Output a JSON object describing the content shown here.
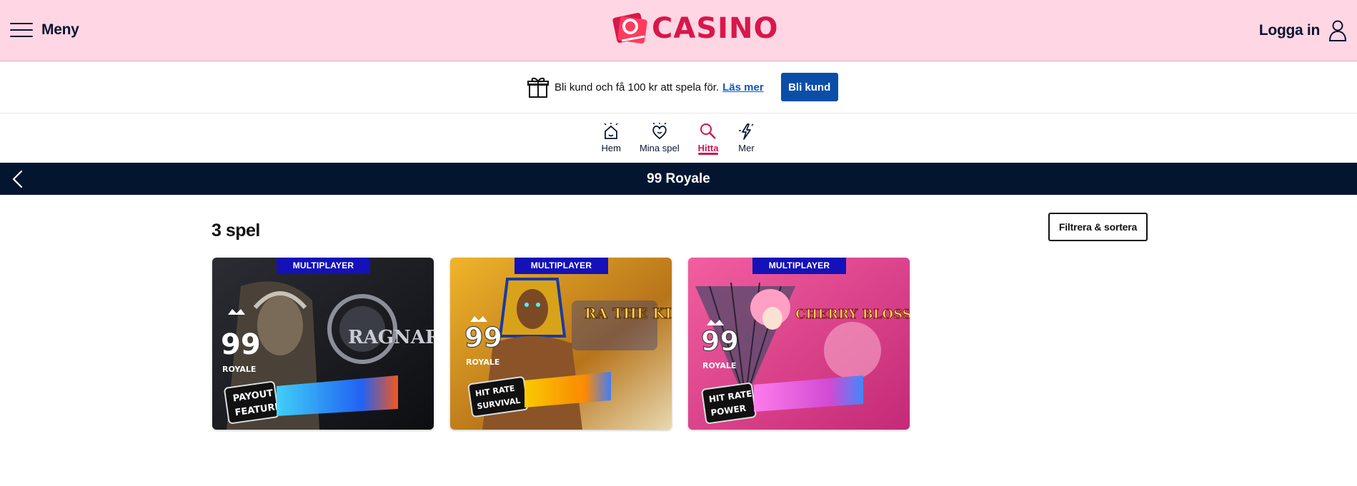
{
  "header": {
    "menu_label": "Meny",
    "logo_text": "CASINO",
    "login_label": "Logga in"
  },
  "promo": {
    "text": "Bli kund och få 100 kr att spela för.",
    "link": "Läs mer",
    "button": "Bli kund"
  },
  "nav": {
    "tabs": [
      {
        "label": "Hem",
        "icon": "home-icon"
      },
      {
        "label": "Mina spel",
        "icon": "heart-icon"
      },
      {
        "label": "Hitta",
        "icon": "search-icon",
        "active": true
      },
      {
        "label": "Mer",
        "icon": "lightning-icon"
      }
    ]
  },
  "titlebar": {
    "title": "99 Royale"
  },
  "content": {
    "count": "3 spel",
    "filter_button": "Filtrera & sortera"
  },
  "games": [
    {
      "badge": "MULTIPLAYER",
      "brand": "99",
      "brand_sub": "ROYALE",
      "title": "RAGNAROK",
      "feature_line1": "PAYOUT",
      "feature_line2": "FEATURE"
    },
    {
      "badge": "MULTIPLAYER",
      "brand": "99",
      "brand_sub": "ROYALE",
      "title": "RA THE KING",
      "feature_line1": "HIT RATE",
      "feature_line2": "SURVIVAL"
    },
    {
      "badge": "MULTIPLAYER",
      "brand": "99",
      "brand_sub": "ROYALE",
      "title": "CHERRY BLOSSOM",
      "feature_line1": "HIT RATE",
      "feature_line2": "POWER"
    }
  ],
  "colors": {
    "header_bg": "#ffd6e4",
    "brand_red": "#d8174b",
    "active_tab": "#cc1452",
    "primary_button": "#0a4ea8",
    "titlebar_bg": "#041530",
    "badge_bg": "#1411b8"
  }
}
